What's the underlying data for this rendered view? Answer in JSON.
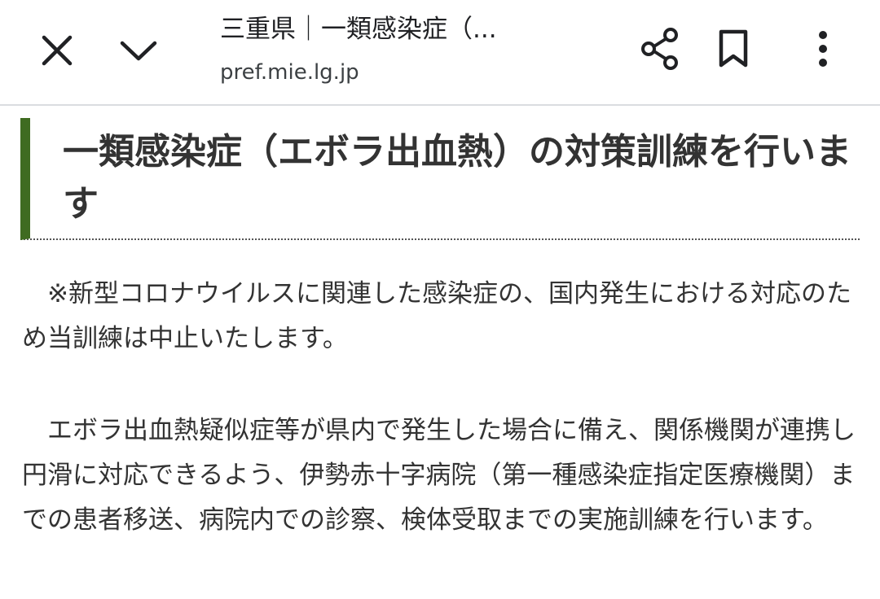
{
  "toolbar": {
    "title": "三重県｜一類感染症（...",
    "url": "pref.mie.lg.jp",
    "icons": {
      "close": "close-icon",
      "collapse": "chevron-down-icon",
      "share": "share-icon",
      "bookmark": "bookmark-icon",
      "menu": "more-vert-icon"
    }
  },
  "article": {
    "heading": "一類感染症（エボラ出血熱）の対策訓練を行います",
    "paragraphs": [
      "※新型コロナウイルスに関連した感染症の、国内発生における対応のため当訓練は中止いたします。",
      "エボラ出血熱疑似症等が県内で発生した場合に備え、関係機関が連携し円滑に対応できるよう、伊勢赤十字病院（第一種感染症指定医療機関）までの患者移送、病院内での診察、検体受取までの実施訓練を行います。"
    ]
  },
  "colors": {
    "heading_accent": "#3f6b21",
    "text": "#333333",
    "toolbar_border": "#dadce0"
  }
}
